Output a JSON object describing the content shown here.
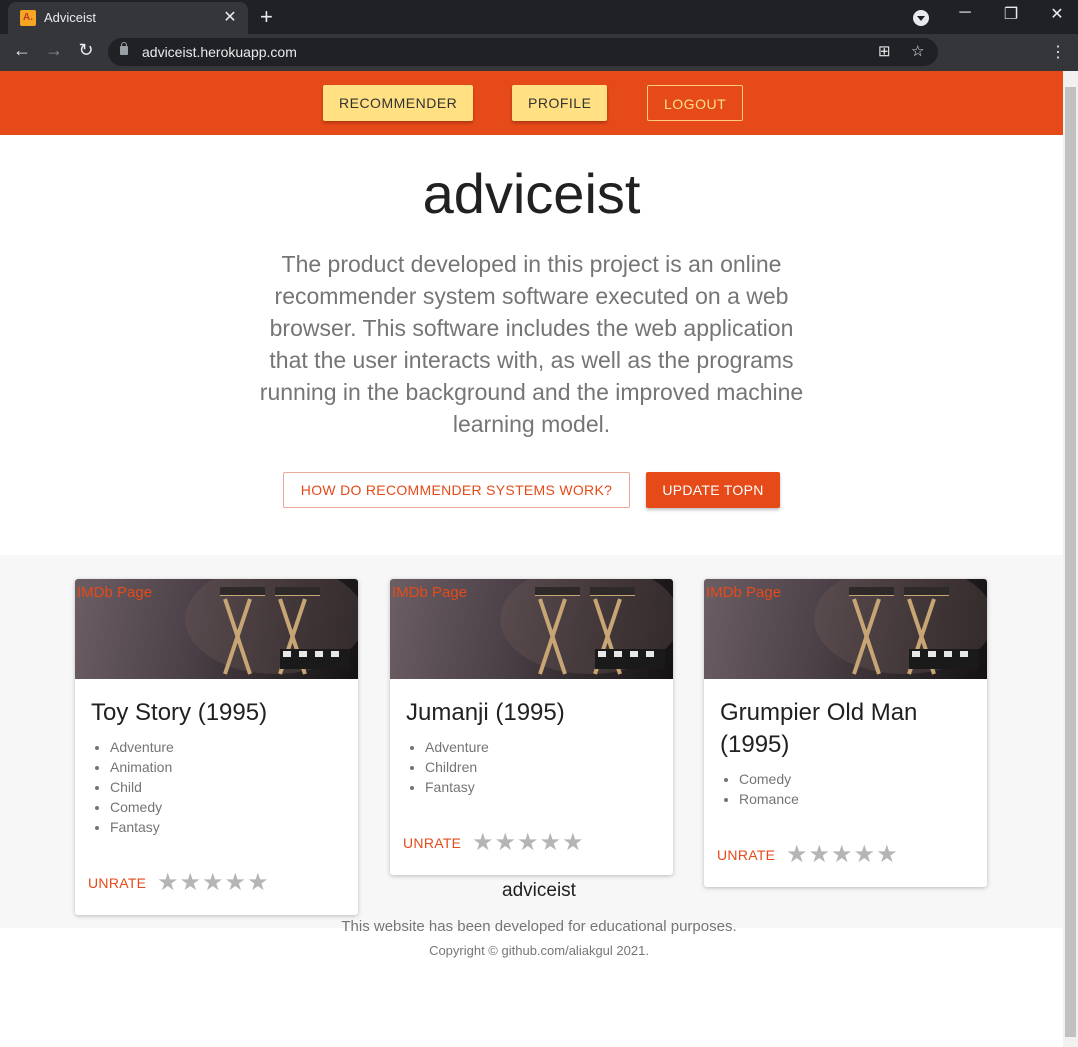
{
  "browser": {
    "tab_title": "Adviceist",
    "favicon_letter": "A.",
    "url": "adviceist.herokuapp.com"
  },
  "navbar": {
    "recommender_label": "RECOMMENDER",
    "profile_label": "PROFILE",
    "logout_label": "LOGOUT"
  },
  "hero": {
    "title": "adviceist",
    "description": "The product developed in this project is an online recommender system software executed on a web browser. This software includes the web application that the user interacts with, as well as the programs running in the background and the improved machine learning model.",
    "how_button": "HOW DO RECOMMENDER SYSTEMS WORK?",
    "update_button": "UPDATE TOPN"
  },
  "cards": [
    {
      "imdb_label": "IMDb Page",
      "title": "Toy Story (1995)",
      "genres": [
        "Adventure",
        "Animation",
        "Child",
        "Comedy",
        "Fantasy"
      ],
      "unrate_label": "UNRATE",
      "rating": 0,
      "max_rating": 5
    },
    {
      "imdb_label": "IMDb Page",
      "title": "Jumanji (1995)",
      "genres": [
        "Adventure",
        "Children",
        "Fantasy"
      ],
      "unrate_label": "UNRATE",
      "rating": 0,
      "max_rating": 5
    },
    {
      "imdb_label": "IMDb Page",
      "title": "Grumpier Old Man (1995)",
      "genres": [
        "Comedy",
        "Romance"
      ],
      "unrate_label": "UNRATE",
      "rating": 0,
      "max_rating": 5
    }
  ],
  "footer": {
    "title": "adviceist",
    "description": "This website has been developed for educational purposes.",
    "copyright": "Copyright © github.com/aliakgul 2021."
  },
  "colors": {
    "accent": "#e64a19",
    "nav_button": "#ffe082"
  },
  "icons": {
    "back": "arrow-left-icon",
    "forward": "arrow-right-icon",
    "reload": "reload-icon",
    "lock": "lock-icon",
    "translate": "translate-icon",
    "bookmark": "star-icon",
    "menu": "kebab-menu-icon",
    "rating": "star-icon"
  }
}
